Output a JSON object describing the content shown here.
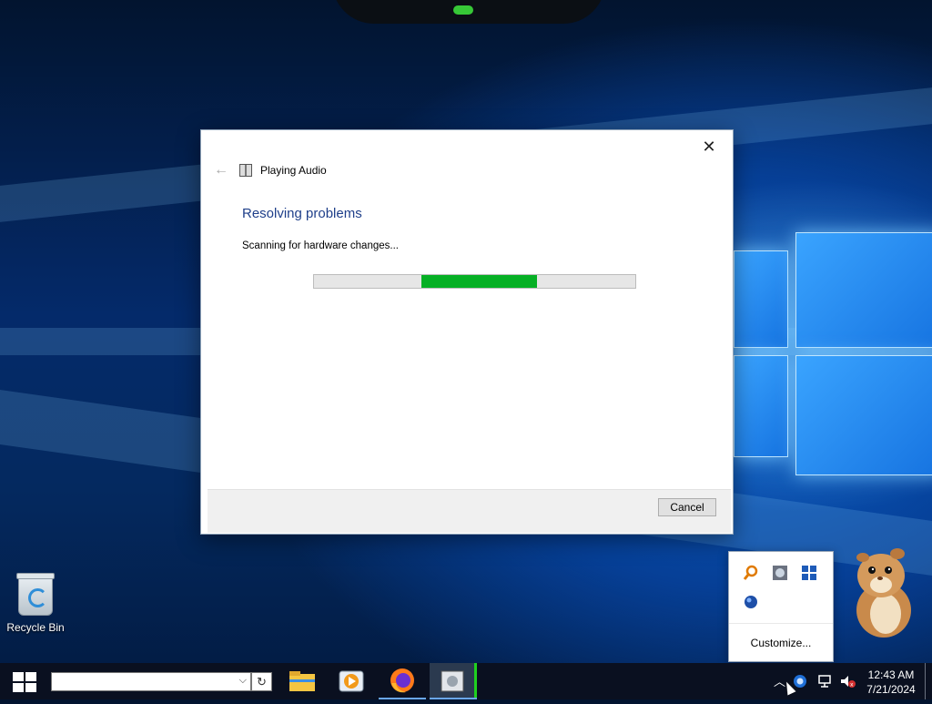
{
  "desktop": {
    "icons": [
      {
        "label": "Recycle Bin",
        "icon": "recycle-bin-icon"
      }
    ]
  },
  "dialog": {
    "title": "Playing Audio",
    "heading": "Resolving problems",
    "status": "Scanning for hardware changes...",
    "progress": {
      "indeterminate": true,
      "color": "#06b025"
    },
    "cancel_label": "Cancel"
  },
  "tray_flyout": {
    "customize_label": "Customize...",
    "icons": [
      "search-tool-icon",
      "network-tool-icon",
      "grid-app-icon",
      "globe-icon"
    ]
  },
  "taskbar": {
    "search_value": "",
    "apps": [
      "file-explorer-icon",
      "media-player-icon",
      "firefox-icon",
      "troubleshooter-icon"
    ],
    "clock": {
      "time": "12:43 AM",
      "date": "7/21/2024"
    }
  },
  "colors": {
    "accent": "#1f3f8a",
    "progress": "#06b025",
    "taskbar": "#0a1020"
  }
}
